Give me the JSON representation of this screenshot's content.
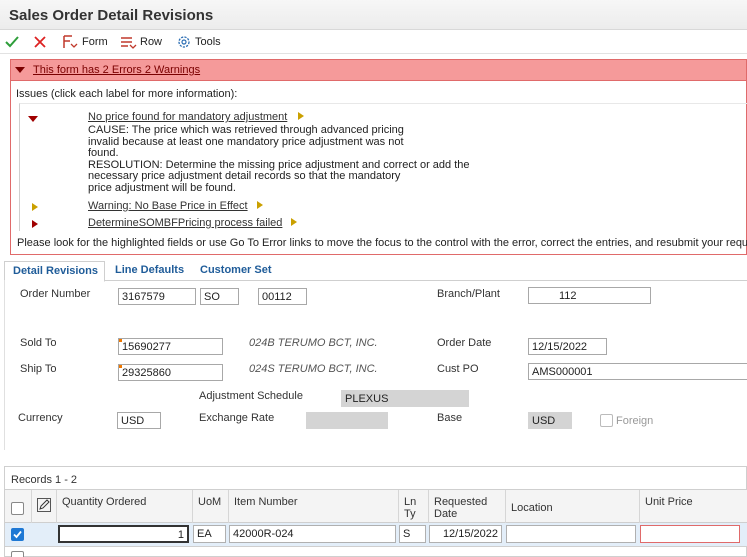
{
  "window": {
    "title": "Sales Order Detail Revisions"
  },
  "toolbar": {
    "form_label": "Form",
    "form_key": "F",
    "row_label": "Row",
    "row_key": "R",
    "tools_label": "Tools"
  },
  "errors": {
    "header": "This form has 2 Errors 2 Warnings",
    "issues_label": "Issues (click each label for more information):",
    "items": [
      {
        "label": "No price found for mandatory adjustment",
        "severity": "error",
        "details": "CAUSE: The price which was retrieved through advanced pricing\ninvalid because at least one mandatory price adjustment was not\nfound.\nRESOLUTION: Determine the missing price adjustment and correct or add the\nnecessary price adjustment detail records so that the mandatory\nprice adjustment will be found."
      },
      {
        "label": "Warning: No Base Price in Effect",
        "severity": "warning"
      },
      {
        "label": "DetermineSOMBFPricing process failed",
        "severity": "error"
      }
    ],
    "footer": "Please look for the highlighted fields or use Go To Error links to move the focus to the control with the error, correct the entries, and resubmit your requ"
  },
  "tabs": [
    "Detail Revisions",
    "Line Defaults",
    "Customer Set"
  ],
  "form": {
    "order_number_label": "Order Number",
    "order_number": "3167579",
    "order_type": "SO",
    "order_company": "00112",
    "branch_plant_label": "Branch/Plant",
    "branch_plant": "112",
    "sold_to_label": "Sold To",
    "sold_to": "15690277",
    "sold_to_name": "024B TERUMO BCT, INC.",
    "order_date_label": "Order Date",
    "order_date": "12/15/2022",
    "ship_to_label": "Ship To",
    "ship_to": "29325860",
    "ship_to_name": "024S TERUMO BCT, INC.",
    "cust_po_label": "Cust PO",
    "cust_po": "AMS000001",
    "adj_schedule_label": "Adjustment Schedule",
    "adj_schedule": "PLEXUS",
    "currency_label": "Currency",
    "currency": "USD",
    "exchange_rate_label": "Exchange Rate",
    "exchange_rate": "",
    "base_label": "Base",
    "base": "USD",
    "foreign_label": "Foreign"
  },
  "grid": {
    "records_label": "Records 1 - 2",
    "columns": [
      "Quantity Ordered",
      "UoM",
      "Item Number",
      "Ln Ty",
      "Requested Date",
      "Location",
      "Unit Price"
    ],
    "rows": [
      {
        "selected": true,
        "quantity": "1",
        "uom": "EA",
        "item": "42000R-024",
        "ln_ty": "S",
        "requested_date": "12/15/2022",
        "location": "",
        "unit_price": ""
      }
    ]
  },
  "colors": {
    "error_header_bg": "#f59a9a",
    "error_border": "#e06a6a",
    "tab_text": "#1f5c99",
    "check_green": "#2e9e3a",
    "close_red": "#d22",
    "selected_row": "#e3eef9"
  }
}
